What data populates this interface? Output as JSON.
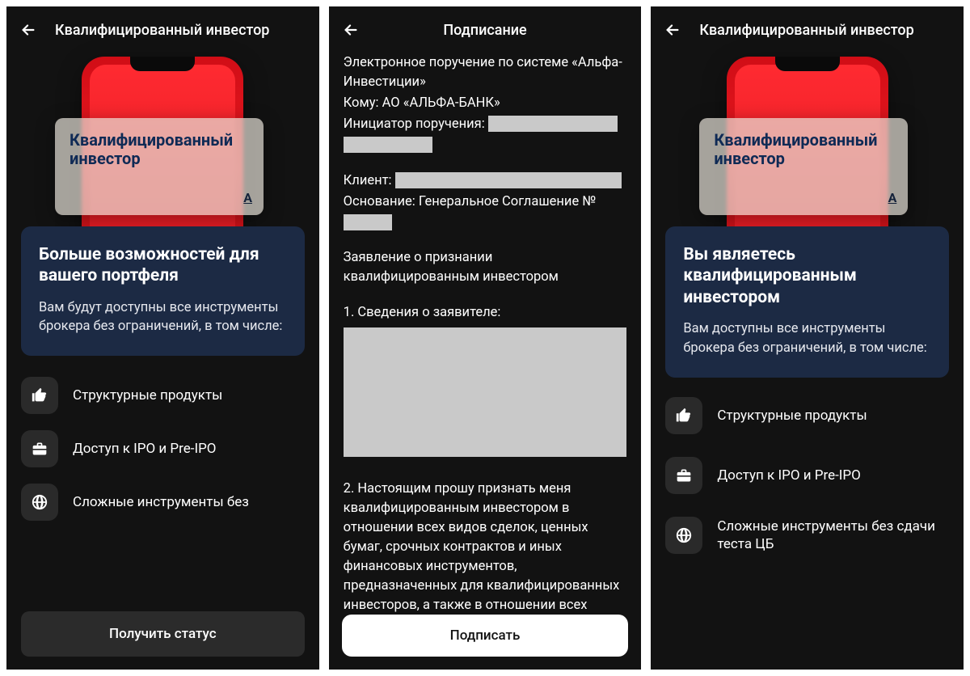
{
  "screen1": {
    "header": "Квалифицированный инвестор",
    "card_title": "Квалифицированный инвестор",
    "card_logo": "A",
    "panel_title": "Больше возможностей для вашего портфеля",
    "panel_text": "Вам будут доступны все инструменты брокера без ограничений, в том числе:",
    "features": [
      "Структурные продукты",
      "Доступ к IPO и Pre-IPO",
      "Сложные инструменты без"
    ],
    "button": "Получить статус"
  },
  "screen2": {
    "header": "Подписание",
    "line1": "Электронное поручение по системе «Альфа-Инвестиции»",
    "to_label": "Кому: АО «АЛЬФА-БАНК»",
    "initiator_label": "Инициатор поручения:",
    "client_label": "Клиент:",
    "basis_label": "Основание: Генеральное Соглашение №",
    "statement": "Заявление о признании квалифицированным инвестором",
    "section1": "1. Сведения о заявителе:",
    "section2": "2. Настоящим прошу признать меня квалифицированным инвестором в отношении всех видов сделок, ценных бумаг, срочных контрактов и иных финансовых инструментов, предназначенных для квалифицированных инвесторов, а также в отношении всех видов услуг, предназначенных для квалифицированных инвесторов",
    "button": "Подписать"
  },
  "screen3": {
    "header": "Квалифицированный инвестор",
    "card_title": "Квалифицированный инвестор",
    "card_logo": "A",
    "panel_title": "Вы являетесь квалифицированным инвестором",
    "panel_text": "Вам доступны все инструменты брокера без ограничений, в том числе:",
    "features": [
      "Структурные продукты",
      "Доступ к IPO и Pre-IPO",
      "Сложные инструменты без сдачи теста ЦБ"
    ]
  }
}
